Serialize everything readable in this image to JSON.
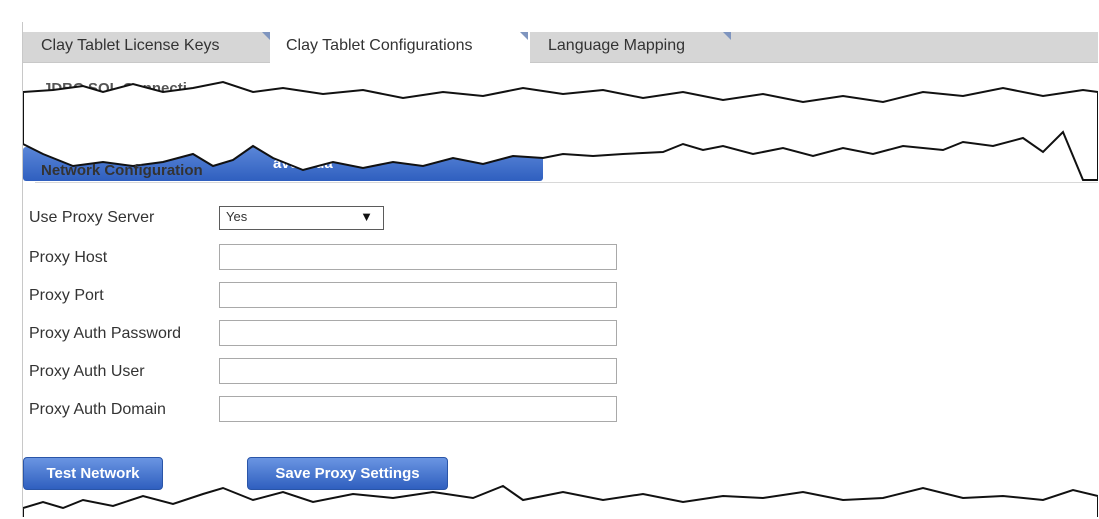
{
  "tabs": [
    {
      "label": "Clay Tablet License Keys"
    },
    {
      "label": "Clay Tablet Configurations"
    },
    {
      "label": "Language Mapping"
    }
  ],
  "partial": {
    "top_label": "JDBC SQL Connecti",
    "button_label": "ave L ua"
  },
  "network": {
    "section_title": "Network Configuration",
    "use_proxy_label": "Use Proxy Server",
    "use_proxy_value": "Yes",
    "fields": [
      {
        "label": "Proxy Host",
        "value": ""
      },
      {
        "label": "Proxy Port",
        "value": ""
      },
      {
        "label": "Proxy Auth Password",
        "value": ""
      },
      {
        "label": "Proxy Auth User",
        "value": ""
      },
      {
        "label": "Proxy Auth Domain",
        "value": ""
      }
    ]
  },
  "buttons": {
    "test": "Test Network",
    "save": "Save Proxy Settings"
  },
  "icons": {
    "select_arrow": "chevron-down-icon"
  },
  "colors": {
    "tab_bar": "#d6d6d6",
    "button_blue": "#2f5fbf",
    "tab_corner": "#7f95bf"
  }
}
